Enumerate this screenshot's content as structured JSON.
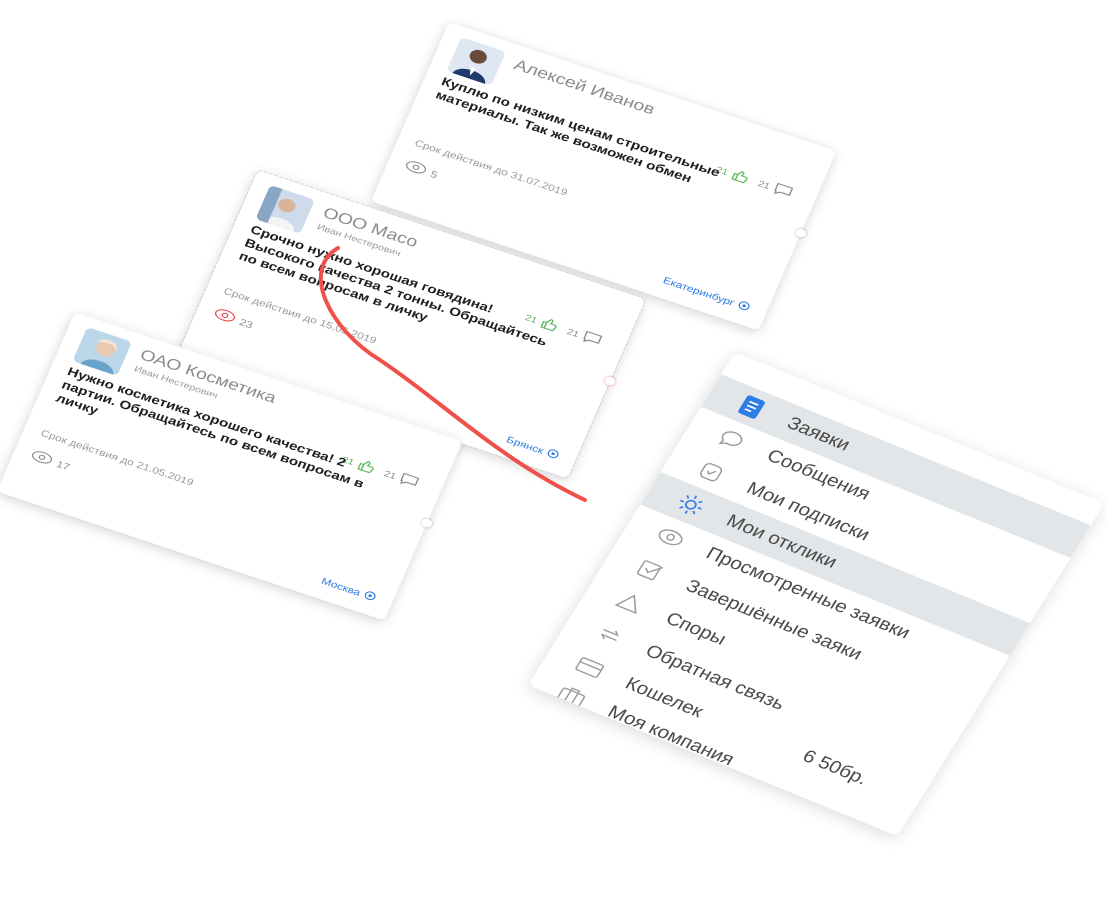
{
  "cards": [
    {
      "author": "Алексей Иванов",
      "person": "",
      "description": "Куплю по низким ценам строительные материалы. Так же возможен обмен",
      "likes": "21",
      "comments": "21",
      "deadline": "Срок действия до 31.07.2019",
      "views": "5",
      "city": "Екатеринбург"
    },
    {
      "author": "ООО Масо",
      "person": "Иван Нестерович",
      "description": "Срочно нужно хорошая говядина! Высокого качества 2 тонны. Обращайтесь по всем вопросам в личку",
      "likes": "21",
      "comments": "21",
      "deadline": "Срок действия до 15.05.2019",
      "views": "23",
      "city": "Брянск"
    },
    {
      "author": "ОАО Косметика",
      "person": "Иван Нестерович",
      "description": "Нужно косметика хорошего качества! 2 партии. Обращайтесь по всем вопросам в личку",
      "likes": "21",
      "comments": "21",
      "deadline": "Срок действия до 21.05.2019",
      "views": "17",
      "city": "Москва"
    }
  ],
  "menu": {
    "items": [
      {
        "label": "Заявки",
        "icon": "document-icon",
        "active": true
      },
      {
        "label": "Сообщения",
        "icon": "chat-icon"
      },
      {
        "label": "Мои подписки",
        "icon": "shield-check-icon"
      },
      {
        "label": "Мои отклики",
        "icon": "sun-icon",
        "active": true
      },
      {
        "label": "Просмотренные заявки",
        "icon": "eye-icon"
      },
      {
        "label": "Завершённые заяки",
        "icon": "checkbox-icon"
      },
      {
        "label": "Споры",
        "icon": "warning-icon"
      },
      {
        "label": "Обратная связь",
        "icon": "refresh-icon"
      },
      {
        "label": "Кошелек",
        "icon": "card-icon",
        "value": "6 50бр."
      },
      {
        "label": "Моя компания",
        "icon": "briefcase-icon"
      }
    ]
  },
  "colors": {
    "accent": "#2d7be5",
    "like_green": "#5cb85c",
    "connector_red": "#f0504a",
    "active_row": "#e3e6e8",
    "views_red": "#e8434b"
  }
}
